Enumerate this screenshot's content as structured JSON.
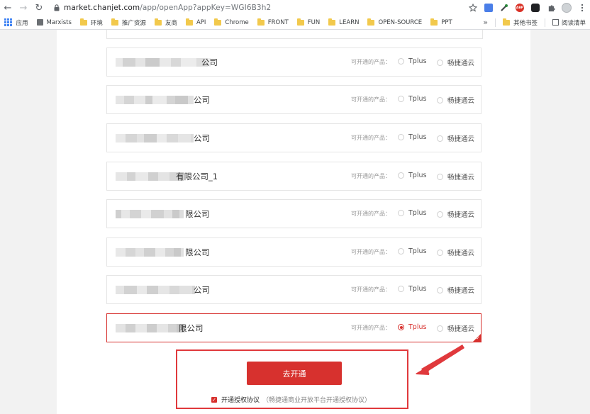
{
  "browser": {
    "url_host": "market.chanjet.com",
    "url_path": "/app/openApp?appKey=WGI6B3h2",
    "extension_badge": "ABP",
    "bookmarks": [
      {
        "label": "应用",
        "icon": "apps-grid-icon"
      },
      {
        "label": "Marxists",
        "icon": "page-icon"
      },
      {
        "label": "环境",
        "icon": "folder-icon"
      },
      {
        "label": "推广资源",
        "icon": "folder-icon"
      },
      {
        "label": "友商",
        "icon": "folder-icon"
      },
      {
        "label": "API",
        "icon": "folder-icon"
      },
      {
        "label": "Chrome",
        "icon": "folder-icon"
      },
      {
        "label": "FRONT",
        "icon": "folder-icon"
      },
      {
        "label": "FUN",
        "icon": "folder-icon"
      },
      {
        "label": "LEARN",
        "icon": "folder-icon"
      },
      {
        "label": "OPEN-SOURCE",
        "icon": "folder-icon"
      },
      {
        "label": "PPT",
        "icon": "folder-icon"
      }
    ],
    "overflow_chevron": "»",
    "other_bookmarks": "其他书签",
    "reading_list": "阅读清单"
  },
  "companies": {
    "product_label": "可开通的产品：",
    "option_tplus": "Tplus",
    "option_cloud": "畅捷通云",
    "items": [
      {
        "name_visible": "公司",
        "selected": false
      },
      {
        "name_visible": "公司",
        "selected": false
      },
      {
        "name_visible": "公司",
        "selected": false
      },
      {
        "name_visible": "有限公司_1",
        "selected": false
      },
      {
        "name_visible": "限公司",
        "selected": false
      },
      {
        "name_visible": "限公司",
        "selected": false
      },
      {
        "name_visible": "公司",
        "selected": false
      },
      {
        "name_visible": "限公司",
        "selected": true,
        "selected_option": "Tplus"
      }
    ]
  },
  "action": {
    "open_button": "去开通",
    "agreement_label": "开通授权协议",
    "agreement_desc": "（畅捷通商业开放平台开通授权协议）",
    "agreement_checked": true
  },
  "colors": {
    "accent": "#d7312e",
    "annotation": "#e0393c",
    "blur_light": "#e6e6e6",
    "blur_dark": "#c9c9c9"
  }
}
